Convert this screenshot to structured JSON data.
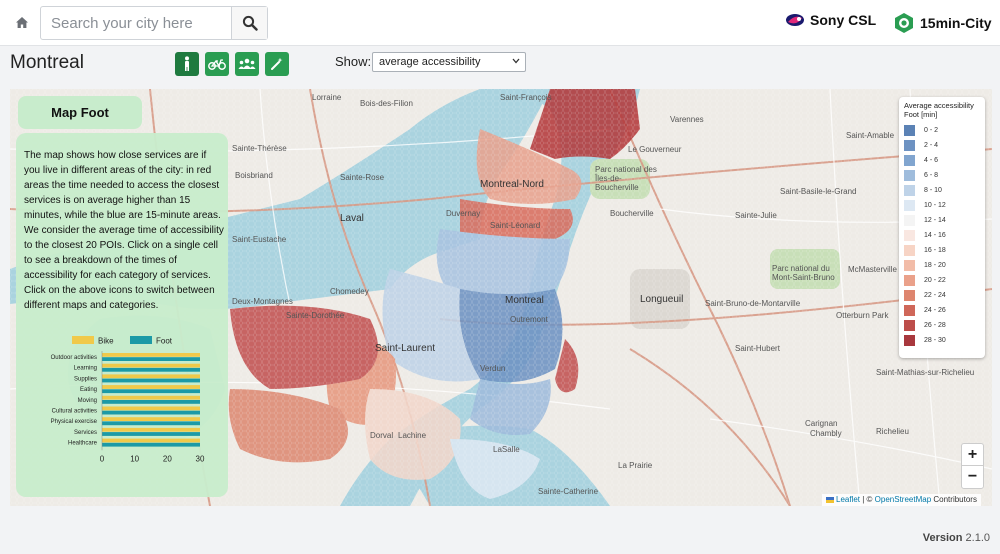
{
  "header": {
    "search": {
      "placeholder": "Search your city here"
    },
    "brand_sony": "Sony CSL",
    "brand_app": "15min-City"
  },
  "toolbar": {
    "city": "Montreal",
    "show_label": "Show:",
    "show_selected": "average accessibility"
  },
  "panel": {
    "title": "Map Foot",
    "description": "The map shows how close services are if you live in different areas of the city: in red areas the time needed to access the closest services is on average higher than 15 minutes, while the blue are 15-minute areas. We consider the average time of accessibility to the closest 20 POIs. Click on a single cell to see a breakdown of the times of accessibility for each category of services. Click on the above icons to switch between different maps and categories."
  },
  "chart_data": {
    "type": "bar",
    "orientation": "horizontal",
    "categories": [
      "Outdoor activities",
      "Learning",
      "Supplies",
      "Eating",
      "Moving",
      "Cultural activities",
      "Physical exercise",
      "Services",
      "Healthcare"
    ],
    "series": [
      {
        "name": "Bike",
        "color": "#f0c94a",
        "values": [
          30,
          30,
          30,
          30,
          30,
          30,
          30,
          30,
          30
        ]
      },
      {
        "name": "Foot",
        "color": "#1c9aa6",
        "values": [
          30,
          30,
          30,
          30,
          30,
          30,
          30,
          30,
          30
        ]
      }
    ],
    "xticks": [
      "0",
      "10",
      "20",
      "30"
    ],
    "xlim": [
      0,
      30
    ],
    "legend_position": "top"
  },
  "legend": {
    "title": "Average accessibility Foot [min]",
    "items": [
      {
        "label": "0 - 2",
        "color": "#5b82b5"
      },
      {
        "label": "2 - 4",
        "color": "#6d92c2"
      },
      {
        "label": "4 - 6",
        "color": "#81a5cf"
      },
      {
        "label": "6 - 8",
        "color": "#9fbcdc"
      },
      {
        "label": "8 - 10",
        "color": "#bfd3e8"
      },
      {
        "label": "10 - 12",
        "color": "#dde8f3"
      },
      {
        "label": "12 - 14",
        "color": "#f4f4f4"
      },
      {
        "label": "14 - 16",
        "color": "#f9e7e1"
      },
      {
        "label": "16 - 18",
        "color": "#f7d4c5"
      },
      {
        "label": "18 - 20",
        "color": "#f2bca8"
      },
      {
        "label": "20 - 22",
        "color": "#eaa18a"
      },
      {
        "label": "22 - 24",
        "color": "#de856e"
      },
      {
        "label": "24 - 26",
        "color": "#cf6759"
      },
      {
        "label": "26 - 28",
        "color": "#bd4d4a"
      },
      {
        "label": "28 - 30",
        "color": "#a8383d"
      }
    ]
  },
  "map": {
    "labels": [
      "Lorraine",
      "Bois-des-Filion",
      "Saint-François",
      "Sainte-Thérèse",
      "Boisbriand",
      "Sainte-Rose",
      "Laval",
      "Duvernay",
      "Saint-Eustache",
      "Chomedey",
      "Montreal-Nord",
      "Saint-Léonard",
      "Montreal",
      "Outremont",
      "Saint-Laurent",
      "Dorval",
      "Lachine",
      "LaSalle",
      "Verdun",
      "Longueuil",
      "Varennes",
      "Le Gouverneur",
      "Parc national des Îles-de-Boucherville",
      "Sainte-Julie",
      "Saint-Amable",
      "Saint-Bruno-de-Montarville",
      "Parc national du Mont-Saint-Bruno",
      "McMasterville",
      "Otterburn Park",
      "Saint-Hubert",
      "Carignan",
      "Chambly",
      "Richelieu",
      "La Prairie",
      "Sainte-Catherine",
      "Deux-Montagnes",
      "Sainte-Dorothée",
      "Saint-Mathias-sur-Richelieu",
      "Saint-Basile-le-Grand",
      "Boucherville"
    ],
    "zoom_in": "+",
    "zoom_out": "−",
    "attribution_leaflet": "Leaflet",
    "attribution_sep": " | © ",
    "attribution_osm": "OpenStreetMap",
    "attribution_tail": " Contributors"
  },
  "footer": {
    "version_label": "Version",
    "version_number": "2.1.0"
  }
}
